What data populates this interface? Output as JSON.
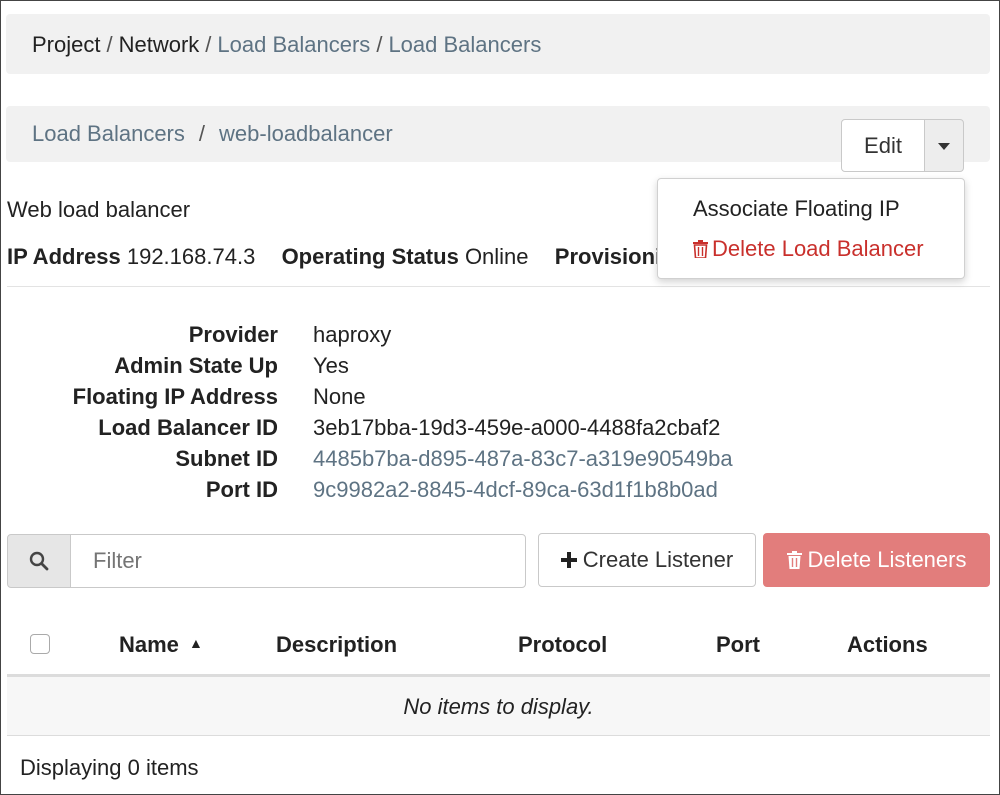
{
  "breadcrumb": {
    "items": [
      "Project",
      "Network",
      "Load Balancers",
      "Load Balancers"
    ],
    "separator": "/"
  },
  "page_header": {
    "crumbs": [
      "Load Balancers",
      "web-loadbalancer"
    ],
    "separator": "/"
  },
  "actions": {
    "edit_label": "Edit",
    "dropdown_icon": "caret-down-icon",
    "menu": [
      {
        "label": "Associate Floating IP",
        "icon": ""
      },
      {
        "label": "Delete Load Balancer",
        "icon": "trash-icon"
      }
    ]
  },
  "summary": {
    "description": "Web load balancer",
    "ip_label": "IP Address",
    "ip_value": "192.168.74.3",
    "op_status_label": "Operating Status",
    "op_status_value": "Online",
    "prov_label_visible": "Provisioni"
  },
  "details": [
    {
      "label": "Provider",
      "value": "haproxy",
      "link": false
    },
    {
      "label": "Admin State Up",
      "value": "Yes",
      "link": false
    },
    {
      "label": "Floating IP Address",
      "value": "None",
      "link": false
    },
    {
      "label": "Load Balancer ID",
      "value": "3eb17bba-19d3-459e-a000-4488fa2cbaf2",
      "link": false
    },
    {
      "label": "Subnet ID",
      "value": "4485b7ba-d895-487a-83c7-a319e90549ba",
      "link": true
    },
    {
      "label": "Port ID",
      "value": "9c9982a2-8845-4dcf-89ca-63d1f1b8b0ad",
      "link": true
    }
  ],
  "toolbar": {
    "search_icon": "search-icon",
    "filter_placeholder": "Filter",
    "create_label": "Create Listener",
    "delete_label": "Delete Listeners"
  },
  "table": {
    "columns": [
      "Name",
      "Description",
      "Protocol",
      "Port",
      "Actions"
    ],
    "sort_indicator": "▲",
    "empty_message": "No items to display.",
    "footer": "Displaying 0 items"
  },
  "colors": {
    "link": "#5e7383",
    "danger": "#c9302c",
    "danger_button_bg": "#e27d7c",
    "panel_bg": "#f1f1f1"
  }
}
